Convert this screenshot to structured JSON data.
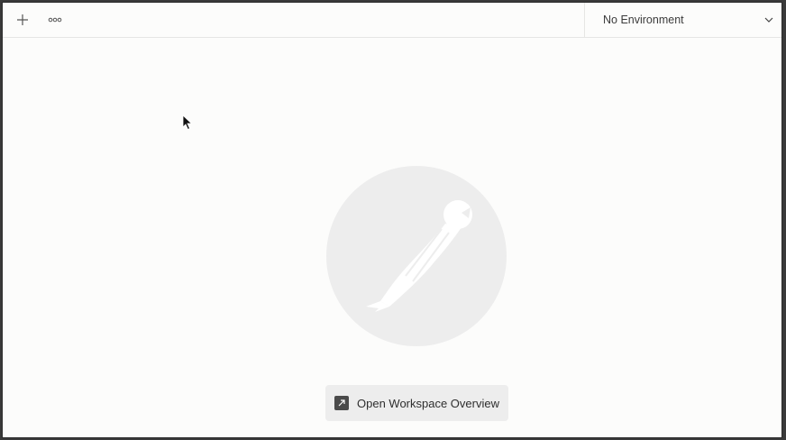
{
  "toolbar": {
    "new_icon": "plus-icon",
    "more_icon": "more-horizontal-icon"
  },
  "environment": {
    "selected": "No Environment",
    "icon": "chevron-down-icon"
  },
  "empty_state": {
    "logo": "postman-logo",
    "button_label": "Open Workspace Overview",
    "button_icon": "open-external-icon"
  },
  "colors": {
    "background": "#fcfcfb",
    "logo_circle": "#ededed",
    "button_bg": "#ededed",
    "icon_dark": "#4a4a4a"
  }
}
